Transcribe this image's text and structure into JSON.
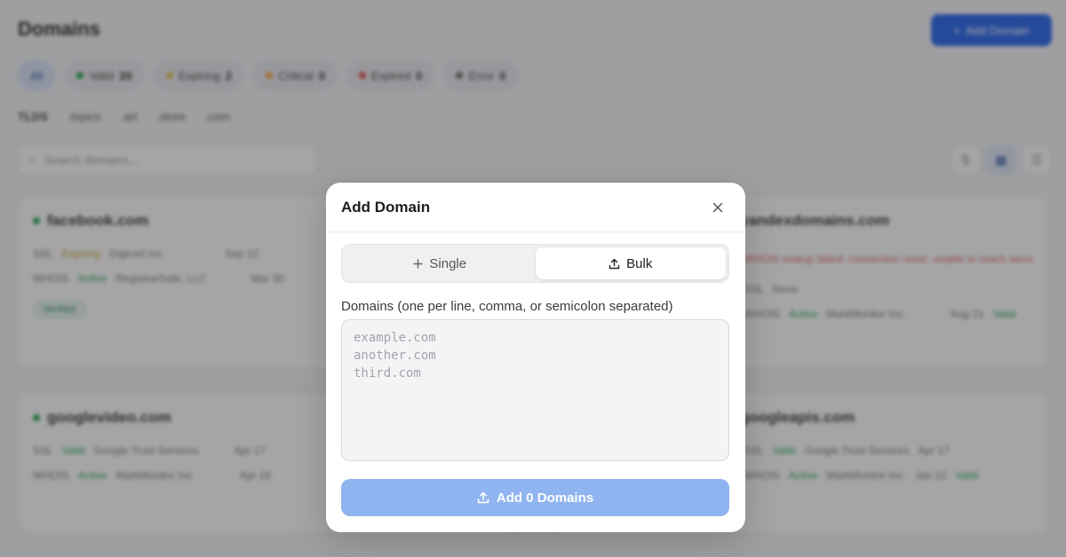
{
  "background": {
    "page_title": "Domains",
    "add_button_label": "Add Domain",
    "filters": [
      {
        "label": "All",
        "count": "",
        "color": "#2a4f9c"
      },
      {
        "label": "Valid",
        "count": "20",
        "color": "#22a34a"
      },
      {
        "label": "Expiring",
        "count": "2",
        "color": "#e3c04a"
      },
      {
        "label": "Critical",
        "count": "0",
        "color": "#f0a040"
      },
      {
        "label": "Expired",
        "count": "0",
        "color": "#e04848"
      },
      {
        "label": "Error",
        "count": "0",
        "color": "#666666"
      }
    ],
    "tlds_label": "TLDS",
    "tlds": [
      ".topics",
      ".art",
      ".store",
      ".com"
    ],
    "search_placeholder": "Search domains...",
    "cards": [
      {
        "name": "facebook.com",
        "row1_label": "SSL",
        "row1_status": "Expiring",
        "row1_detail": "Digicert Inc",
        "row1_date": "Sep 12",
        "row2_label": "WHOIS",
        "row2_status": "Active",
        "row2_detail": "RegistrarSafe, LLC",
        "row2_date": "Mar 30",
        "pill": "Verified"
      },
      {
        "name": "yandexdomains.com",
        "error_line": "WHOIS lookup failed: connection reset, unable to reach server",
        "row1_label": "SSL",
        "row1_status": "None",
        "row2_label": "WHOIS",
        "row2_status": "Active",
        "row2_detail": "MarkMonitor Inc.",
        "row2_date": "Aug 21",
        "row2_badge": "Valid"
      },
      {
        "name": "googlevideo.com",
        "row1_label": "SSL",
        "row1_status": "Valid",
        "row1_detail": "Google Trust Services",
        "row1_date": "Apr 17",
        "row2_label": "WHOIS",
        "row2_status": "Active",
        "row2_detail": "MarkMonitor Inc.",
        "row2_date": "Apr 16"
      },
      {
        "name": "googleapis.com",
        "row1_label": "SSL",
        "row1_status": "Valid",
        "row1_detail": "Google Trust Services",
        "row1_date": "Apr 17",
        "row2_label": "WHOIS",
        "row2_status": "Active",
        "row2_detail": "MarkMonitor Inc.",
        "row2_date": "Jan 12",
        "row2_badge": "Valid"
      }
    ]
  },
  "modal": {
    "title": "Add Domain",
    "tabs": [
      {
        "label": "Single",
        "icon": "plus-icon",
        "active": false
      },
      {
        "label": "Bulk",
        "icon": "upload-icon",
        "active": true
      }
    ],
    "field_label": "Domains (one per line, comma, or semicolon separated)",
    "textarea_placeholder": "example.com\nanother.com\nthird.com",
    "textarea_value": "",
    "submit_label": "Add 0 Domains",
    "accent_color": "#90b4ef"
  }
}
